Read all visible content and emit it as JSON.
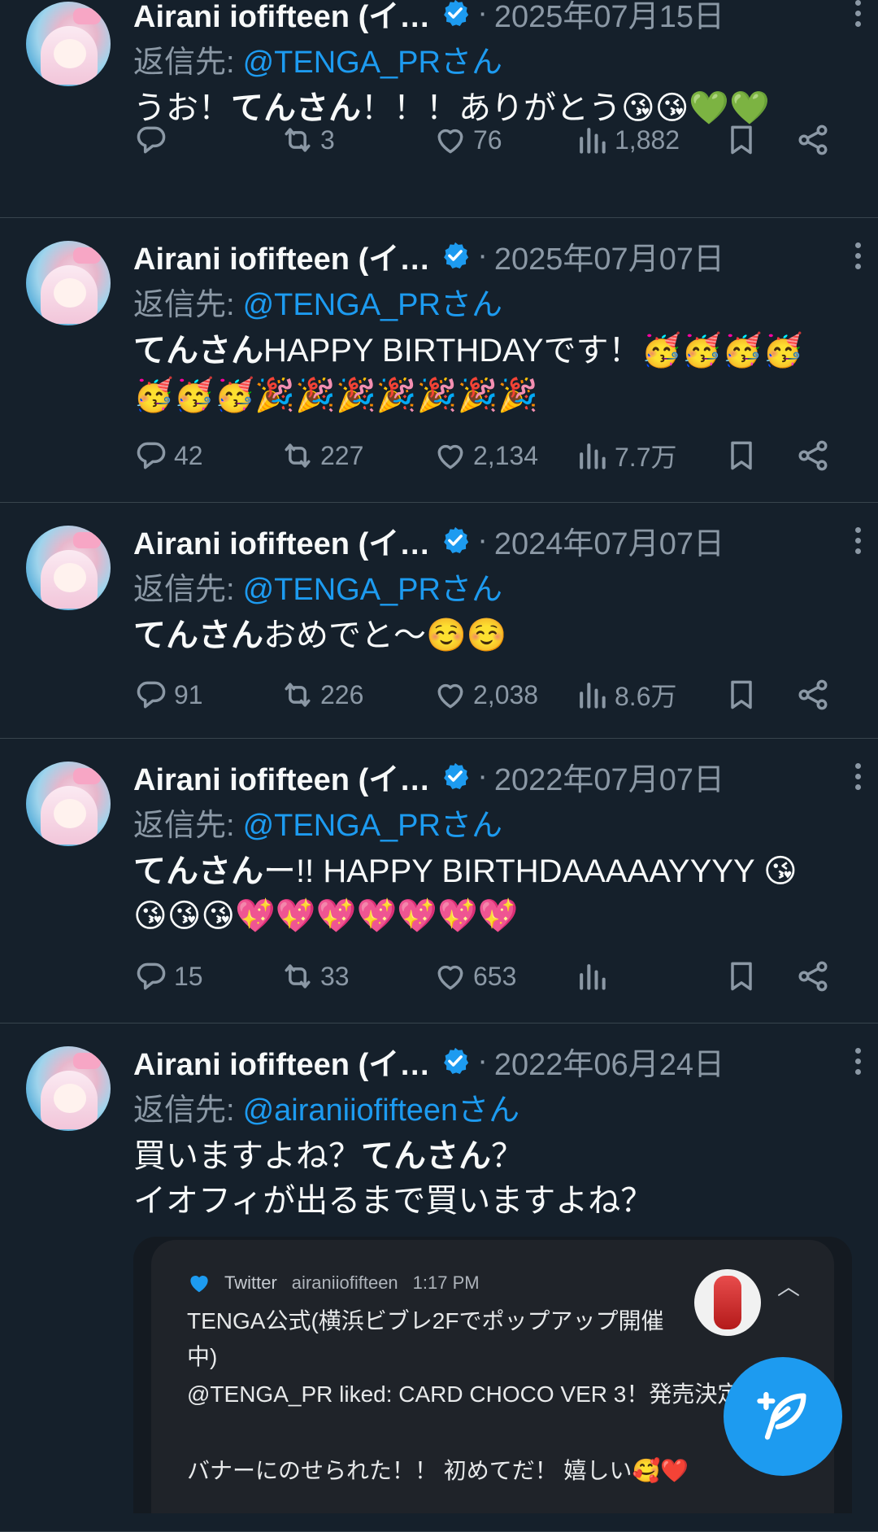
{
  "tweets": [
    {
      "name": "Airani iofifteen (イ…",
      "date": "2025年07月15日",
      "reply_prefix": "返信先:",
      "reply_handle": "@TENGA_PRさん",
      "body": [
        [
          {
            "t": "うお！"
          },
          {
            "t": "てんさん",
            "b": true
          },
          {
            "t": "！！！ありがとう😘😘💚💚"
          }
        ]
      ],
      "stats": {
        "replies": "",
        "retweets": "3",
        "likes": "76",
        "views": "1,882"
      }
    },
    {
      "name": "Airani iofifteen (イ…",
      "date": "2025年07月07日",
      "reply_prefix": "返信先:",
      "reply_handle": "@TENGA_PRさん",
      "body": [
        [
          {
            "t": "てんさん",
            "b": true
          },
          {
            "t": "HAPPY BIRTHDAYです！🥳🥳🥳🥳"
          }
        ],
        [
          {
            "t": "🥳🥳🥳🎉🎉🎉🎉🎉🎉🎉"
          }
        ]
      ],
      "stats": {
        "replies": "42",
        "retweets": "227",
        "likes": "2,134",
        "views": "7.7万"
      }
    },
    {
      "name": "Airani iofifteen (イ…",
      "date": "2024年07月07日",
      "reply_prefix": "返信先:",
      "reply_handle": "@TENGA_PRさん",
      "body": [
        [
          {
            "t": "てんさん",
            "b": true
          },
          {
            "t": "おめでと〜☺️☺️"
          }
        ]
      ],
      "stats": {
        "replies": "91",
        "retweets": "226",
        "likes": "2,038",
        "views": "8.6万"
      }
    },
    {
      "name": "Airani iofifteen (イ…",
      "date": "2022年07月07日",
      "reply_prefix": "返信先:",
      "reply_handle": "@TENGA_PRさん",
      "body": [
        [
          {
            "t": "てんさん",
            "b": true
          },
          {
            "t": "ー!! HAPPY BIRTHDAAAAAYYYY 😘"
          }
        ],
        [
          {
            "t": "😘😘😘💖💖💖💖💖💖💖"
          }
        ]
      ],
      "stats": {
        "replies": "15",
        "retweets": "33",
        "likes": "653",
        "views": ""
      }
    },
    {
      "name": "Airani iofifteen (イ…",
      "date": "2022年06月24日",
      "reply_prefix": "返信先:",
      "reply_handle": "@airaniiofifteenさん",
      "body": [
        [
          {
            "t": "買いますよね？"
          },
          {
            "t": "てんさん",
            "b": true
          },
          {
            "t": "？"
          }
        ],
        [
          {
            "t": "イオフィが出るまで買いますよね？"
          }
        ]
      ],
      "stats": null
    }
  ],
  "embed": {
    "app": "Twitter",
    "account": "airaniiofifteen",
    "time": "1:17 PM",
    "title": "TENGA公式(横浜ビブレ2Fでポップアップ開催中)",
    "line1": "@TENGA_PR liked: CARD CHOCO VER 3！発売決定",
    "line2": "バナーにのせられた！！ 初めてだ！ 嬉しい🥰❤️"
  },
  "colors": {
    "background": "#15202b",
    "accent": "#1d9bf0",
    "muted": "#8b98a5",
    "text": "#f7f9f9",
    "divider": "#38444d"
  },
  "icons": {
    "reply": "reply-icon",
    "retweet": "retweet-icon",
    "like": "heart-icon",
    "views": "views-icon",
    "bookmark": "bookmark-icon",
    "share": "share-icon",
    "compose": "compose-icon"
  }
}
